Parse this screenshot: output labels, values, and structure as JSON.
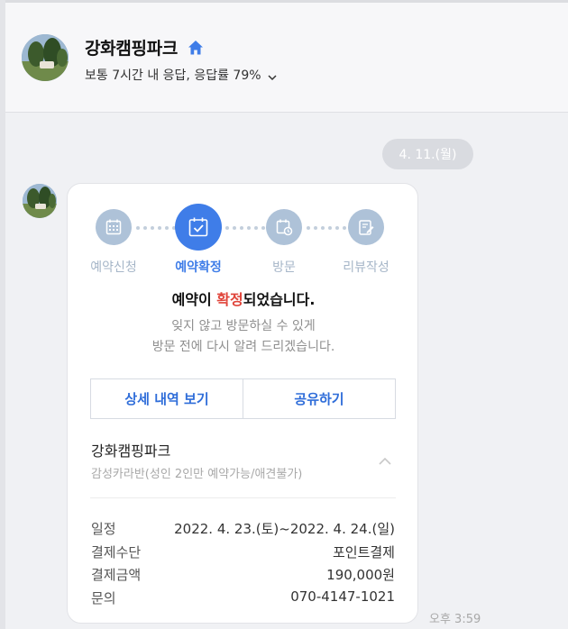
{
  "header": {
    "title": "강화캠핑파크",
    "subtitle": "보통 7시간 내 응답, 응답률 79%"
  },
  "chat": {
    "date": "4. 11.(월)",
    "time": "오후 3:59"
  },
  "card": {
    "steps": [
      {
        "label": "예약신청",
        "icon": "calendar-grid-icon",
        "active": false
      },
      {
        "label": "예약확정",
        "icon": "calendar-check-icon",
        "active": true
      },
      {
        "label": "방문",
        "icon": "calendar-clock-icon",
        "active": false
      },
      {
        "label": "리뷰작성",
        "icon": "review-edit-icon",
        "active": false
      }
    ],
    "title_pre": "예약이 ",
    "title_accent": "확정",
    "title_post": "되었습니다.",
    "desc_line1": "잊지 않고 방문하실 수 있게",
    "desc_line2": "방문 전에 다시 알려 드리겠습니다.",
    "buttons": {
      "details": "상세 내역 보기",
      "share": "공유하기"
    },
    "place": {
      "name": "강화캠핑파크",
      "option": "감성카라반(성인 2인만 예약가능/애견불가)"
    },
    "info": [
      {
        "label": "일정",
        "value": "2022. 4. 23.(토)~2022. 4. 24.(일)"
      },
      {
        "label": "결제수단",
        "value": "포인트결제"
      },
      {
        "label": "결제금액",
        "value": "190,000원"
      },
      {
        "label": "문의",
        "value": "070-4147-1021"
      }
    ]
  },
  "colors": {
    "accent": "#3f7de8",
    "highlight": "#e0443a",
    "step_inactive": "#aec2d8"
  }
}
